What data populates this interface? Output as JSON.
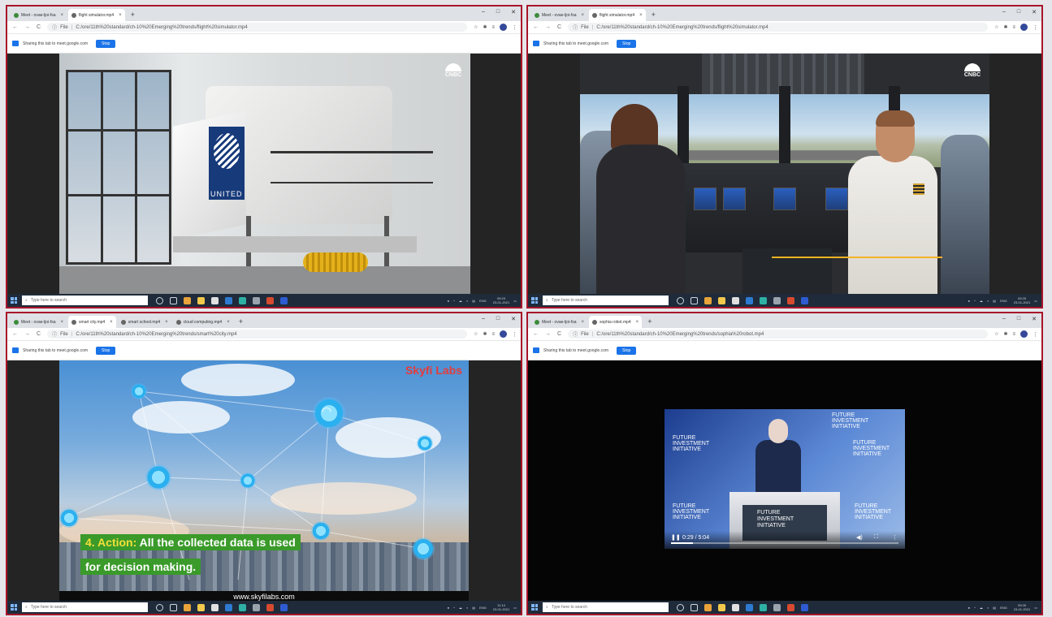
{
  "common": {
    "meet_tab": "Meet - ovae-ljoi-fsa",
    "sharing": "Sharing this tab to meet.google.com",
    "stop": "Stop",
    "file_label": "File",
    "search_placeholder": "Type here to search",
    "lang": "ENG",
    "close_glyph": "×",
    "new_tab_glyph": "+"
  },
  "panes": [
    {
      "tabs": [
        "Meet - ovae-ljoi-fsa",
        "flight simulator.mp4"
      ],
      "url": "C:/ore/11th%20standard/ch-10%20Emerging%20trends/flight%20simulator.mp4",
      "time": "09:23",
      "date": "23-01-2021"
    },
    {
      "tabs": [
        "Meet - ovae-ljoi-fsa",
        "flight simulator.mp4"
      ],
      "url": "C:/ore/11th%20standard/ch-10%20Emerging%20trends/flight%20simulator.mp4",
      "time": "09:25",
      "date": "23-01-2021"
    },
    {
      "tabs": [
        "Meet - ovae-ljoi-fsa",
        "smart city.mp4",
        "smart school.mp4",
        "cloud computing.mp4"
      ],
      "url": "C:/ore/11th%20standard/ch-10%20Emerging%20trends/smart%20city.mp4",
      "time": "11:14",
      "date": "23-01-2021"
    },
    {
      "tabs": [
        "Meet - ovae-ljoi-fsa",
        "sophia robot.mp4"
      ],
      "url": "C:/ore/11th%20standard/ch-10%20Emerging%20trends/sophia%20robot.mp4",
      "time": "09:26",
      "date": "23-01-2021"
    }
  ],
  "video1": {
    "watermark": "CNBC",
    "logo_text": "UNITED"
  },
  "video2": {
    "watermark": "CNBC"
  },
  "video3": {
    "watermark": "Skyfi Labs",
    "caption_keyword": "4. Action:",
    "caption_line1": "All the collected data is used",
    "caption_line2": "for decision making.",
    "site": "www.skyfilabs.com"
  },
  "video4": {
    "brand_line1": "FUTURE",
    "brand_line2": "INVESTMENT",
    "brand_line3": "INITIATIVE",
    "time_display": "0:29 / 5:04",
    "progress": 0.095
  },
  "colors": {
    "accent": "#1a73e8",
    "border": "#a8152a",
    "taskbar": "#1f2b3a",
    "caption_bg": "#3a9a2a",
    "caption_keyword": "#f4e03a"
  }
}
